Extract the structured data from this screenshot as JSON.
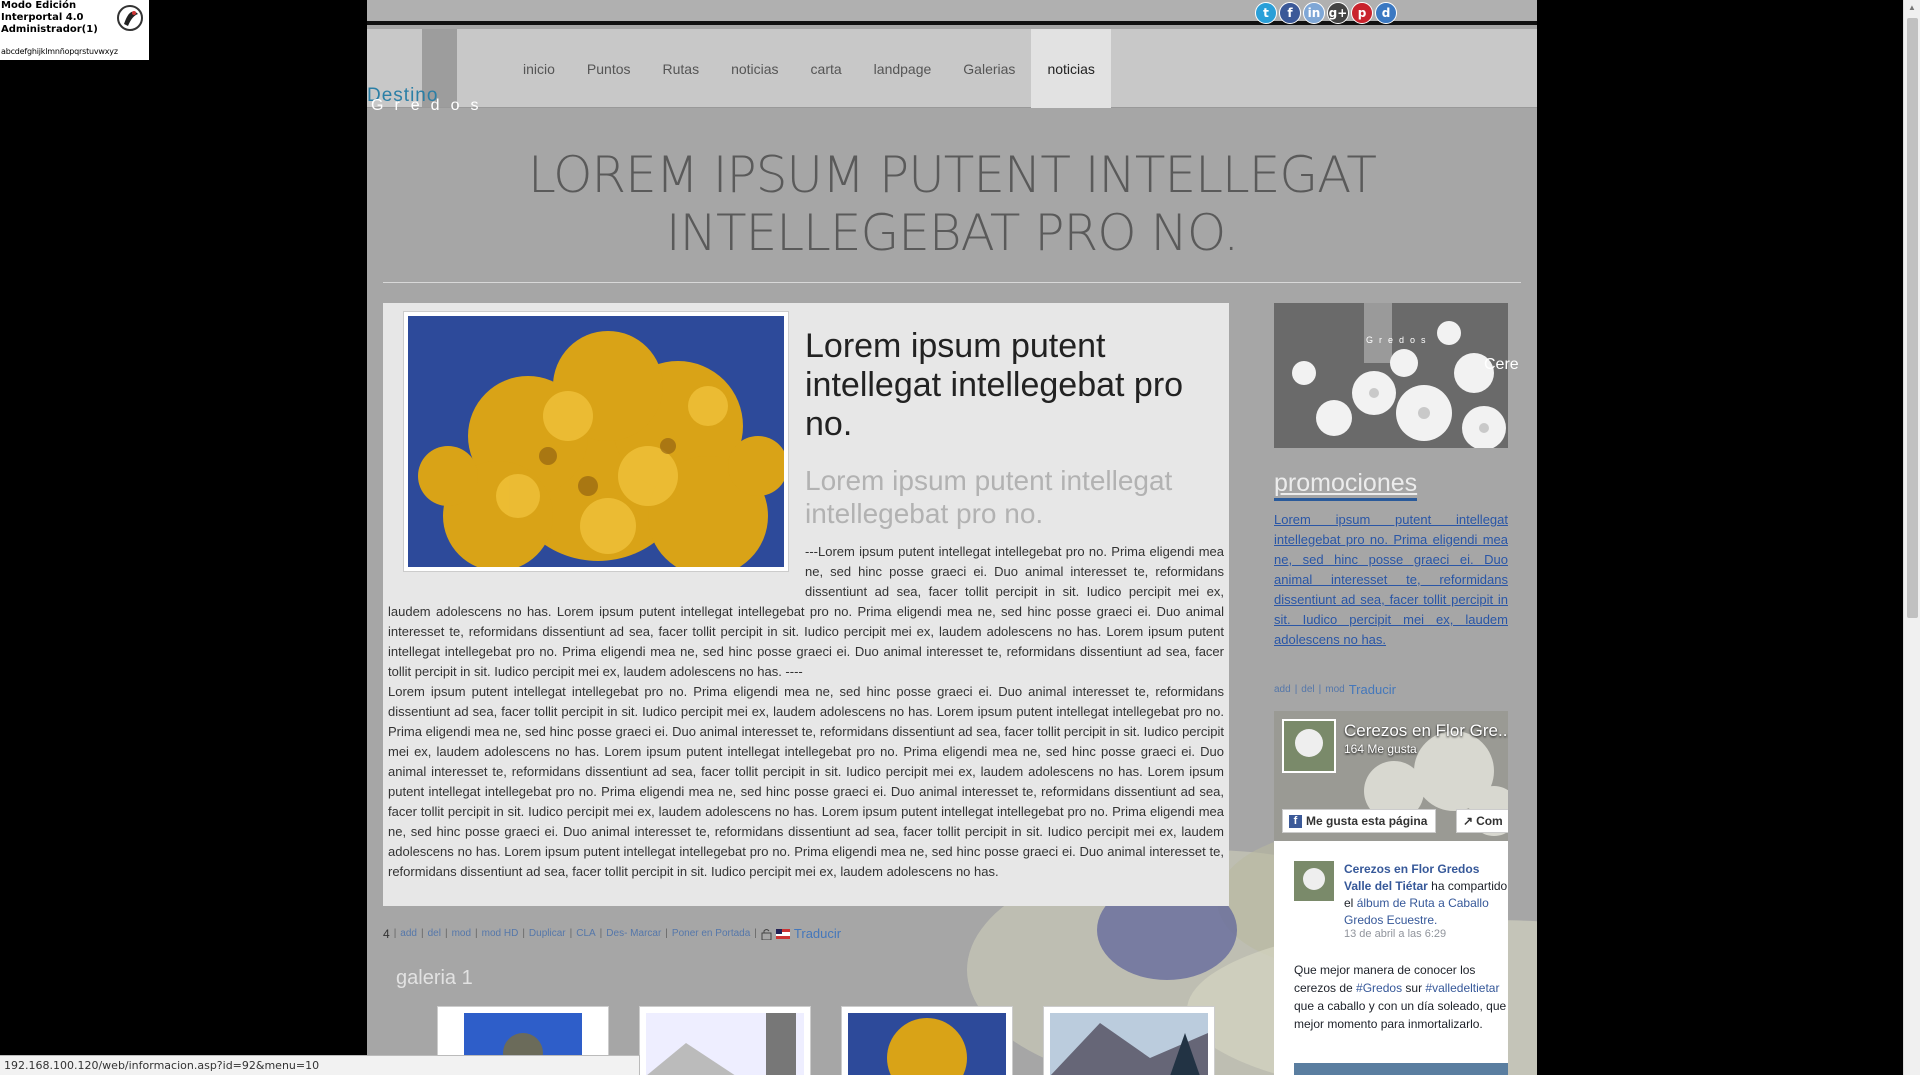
{
  "admin": {
    "line1": "Modo Edición",
    "line2": "Interportal 4.0",
    "line3": "Administrador(1)",
    "alphabet": "abcdefghijklmnñopqrstuvwxyz"
  },
  "social": [
    "t",
    "f",
    "in",
    "g+",
    "p",
    "d"
  ],
  "logo": {
    "word1": "Destino",
    "word2": "Gredos"
  },
  "menu": [
    {
      "label": "inicio"
    },
    {
      "label": "Puntos"
    },
    {
      "label": "Rutas"
    },
    {
      "label": "noticias"
    },
    {
      "label": "carta"
    },
    {
      "label": "landpage"
    },
    {
      "label": "Galerias"
    },
    {
      "label": "noticias",
      "active": true
    }
  ],
  "page_title": "LOREM IPSUM PUTENT INTELLEGAT INTELLEGEBAT PRO NO.",
  "article": {
    "heading": "Lorem ipsum putent intellegat intellegebat pro no.",
    "subheading": "Lorem ipsum putent intellegat intellegebat pro no.",
    "paragraph1": "---Lorem ipsum putent intellegat intellegebat pro no. Prima eligendi mea ne, sed hinc posse graeci ei. Duo animal interesset te, reformidans dissentiunt ad sea, facer tollit percipit in sit. Iudico percipit mei ex, laudem adolescens no has. Lorem ipsum putent intellegat intellegebat pro no. Prima eligendi mea ne, sed hinc posse graeci ei. Duo animal interesset te, reformidans dissentiunt ad sea, facer tollit percipit in sit. Iudico percipit mei ex, laudem adolescens no has. Lorem ipsum putent intellegat intellegebat pro no. Prima eligendi mea ne, sed hinc posse graeci ei. Duo animal interesset te, reformidans dissentiunt ad sea, facer tollit percipit in sit. Iudico percipit mei ex, laudem adolescens no has. ----",
    "paragraph2": "Lorem ipsum putent intellegat intellegebat pro no. Prima eligendi mea ne, sed hinc posse graeci ei. Duo animal interesset te, reformidans dissentiunt ad sea, facer tollit percipit in sit. Iudico percipit mei ex, laudem adolescens no has. Lorem ipsum putent intellegat intellegebat pro no. Prima eligendi mea ne, sed hinc posse graeci ei. Duo animal interesset te, reformidans dissentiunt ad sea, facer tollit percipit in sit. Iudico percipit mei ex, laudem adolescens no has. Lorem ipsum putent intellegat intellegebat pro no. Prima eligendi mea ne, sed hinc posse graeci ei. Duo animal interesset te, reformidans dissentiunt ad sea, facer tollit percipit in sit. Iudico percipit mei ex, laudem adolescens no has. Lorem ipsum putent intellegat intellegebat pro no. Prima eligendi mea ne, sed hinc posse graeci ei. Duo animal interesset te, reformidans dissentiunt ad sea, facer tollit percipit in sit. Iudico percipit mei ex, laudem adolescens no has. Lorem ipsum putent intellegat intellegebat pro no. Prima eligendi mea ne, sed hinc posse graeci ei. Duo animal interesset te, reformidans dissentiunt ad sea, facer tollit percipit in sit. Iudico percipit mei ex, laudem adolescens no has. Lorem ipsum putent intellegat intellegebat pro no. Prima eligendi mea ne, sed hinc posse graeci ei. Duo animal interesset te, reformidans dissentiunt ad sea, facer tollit percipit in sit. Iudico percipit mei ex, laudem adolescens no has."
  },
  "tools": {
    "count": "4",
    "items": [
      "add",
      "del",
      "mod",
      "mod HD",
      "Duplicar",
      "CLA",
      "Des- Marcar",
      "Poner en Portada"
    ],
    "translate": "Traducir"
  },
  "gallery": {
    "title": "galeria 1"
  },
  "sidebar": {
    "promo_heading": "promociones",
    "promo_text": "Lorem ipsum putent intellegat intellegebat pro no. Prima eligendi mea ne, sed hinc posse graeci ei. Duo animal interesset te, reformidans dissentiunt ad sea, facer tollit percipit in sit. Iudico percipit mei ex, laudem adolescens no has.",
    "promo_tools": [
      "add",
      "del",
      "mod"
    ],
    "translate": "Traducir",
    "banner_text": "Cere"
  },
  "facebook": {
    "page_name": "Cerezos en Flor Gre...",
    "likes": "164 Me gusta",
    "like_button": "Me gusta esta página",
    "share_button": "Com",
    "post_author": "Cerezos en Flor Gredos Valle del Tiétar",
    "post_action": " ha compartido el ",
    "post_link": "álbum de Ruta a Caballo Gredos Ecuestre.",
    "post_date": "13 de abril a las 6:29",
    "post_text_1": "Que mejor manera de conocer los cerezos de ",
    "post_tag_1": "#Gredos",
    "post_text_2": " sur ",
    "post_tag_2": "#valledeltietar",
    "post_text_3": " que a caballo y con un día soleado, que mejor momento para inmortalizarlo."
  },
  "status_url": "192.168.100.120/web/informacion.asp?id=92&menu=10",
  "colors": {
    "page_bg": "#a6a6a6",
    "nav_bg": "#c8c8c8",
    "link": "#2a56a6",
    "accent": "#2b7fa6"
  }
}
